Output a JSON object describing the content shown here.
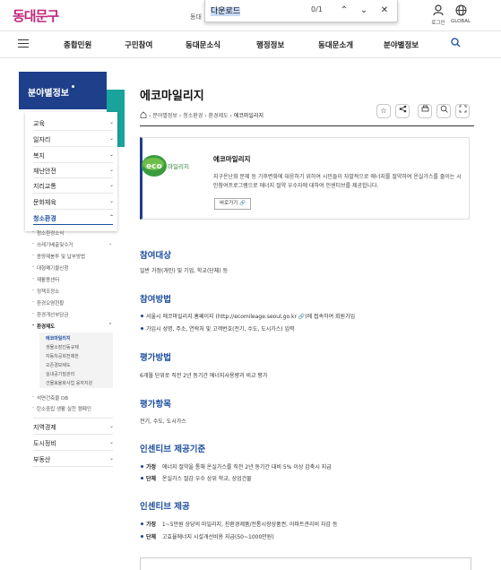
{
  "header": {
    "logo": "동대문구",
    "partial_text": "동대",
    "login": "로그인",
    "global": "GLOBAL"
  },
  "find": {
    "query": "다운로드",
    "count": "0/1",
    "up": "⌃",
    "down": "⌄",
    "close": "✕"
  },
  "nav": [
    "종합민원",
    "구민참여",
    "동대문소식",
    "행정정보",
    "동대문소개",
    "분야별정보"
  ],
  "sidebar": {
    "title": "분야별정보",
    "items": [
      "교육",
      "일자리",
      "복지",
      "재난안전",
      "지리교통",
      "문화체육",
      "청소환경"
    ],
    "sub_items": [
      "청소환경소식",
      "쓰레기배출및수거",
      "종량제봉투 및 납부방법",
      "대형폐기물신청",
      "재활용센터",
      "정책조정소",
      "환경오염현황",
      "환경개선부담금",
      "환경제도"
    ],
    "subsub_items": [
      "에코마일리지",
      "생물소장진동규제",
      "자동차공회전제한",
      "오존경보제도",
      "실내공기질관리",
      "건물효율화사업 융자지원"
    ],
    "more_items": [
      "석면건축물 DB",
      "탄소중립 생활 실천 캠페인"
    ],
    "bottom_items": [
      "지역경제",
      "도시정비",
      "부동산"
    ]
  },
  "page": {
    "title": "에코마일리지",
    "breadcrumb": [
      "분야별정보",
      "청소환경",
      "환경제도",
      "에코마일리지"
    ],
    "intro_title": "에코마일리지",
    "intro_desc": "지구온난화 문제 등 기후변화에 대응하기 위하여 시민들이 자발적으로 에너지를 절약하여 온실가스를 줄이는 시민참여프로그램으로 에너지 절약 우수자에 대하여 인센티브를 제공합니다.",
    "shortcut": "바로가기 🔗",
    "logo_text": "eco 마일리지"
  },
  "sections": {
    "s1_title": "참여대상",
    "s1_text": "일반 가정(개인) 및 기업, 학교(단체) 등",
    "s2_title": "참여방법",
    "s2_b1": "서울시 에코마일리지 홈페이지 (http://ecomileage.seoul.go.kr 🔗)에 접속하여 회원가입",
    "s2_b2": "가입시 성명, 주소, 연락처 및 고객번호(전기, 수도, 도시가스) 입력",
    "s3_title": "평가방법",
    "s3_text": "6개월 단위로 직전 2년 동기간 에너지사용량과 비교 평가",
    "s4_title": "평가항목",
    "s4_text": "전기, 수도, 도시가스",
    "s5_title": "인센티브 제공기준",
    "s5_l1": "가정",
    "s5_t1": "에너지 절약을 통해 온실가스를 직전 2년 동기간 대비 5% 이상 감축시 지급",
    "s5_l2": "단체",
    "s5_t2": "온실가스 절감 우수 상위 학교, 상업건물",
    "s6_title": "인센티브 제공",
    "s6_l1": "가정",
    "s6_t1": "1~5만원 상당의 마일리지, 친환경제품/전통시장상품권, 아파트관리비 차감 등",
    "s6_l2": "단체",
    "s6_t2": "고효율에너지 시설개선비용 지급(50~1000만원)"
  }
}
